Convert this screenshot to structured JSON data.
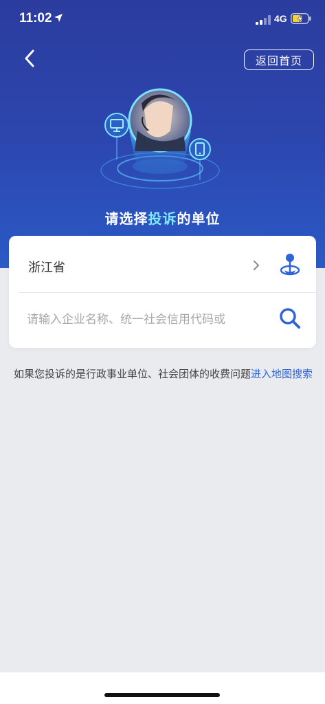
{
  "status_bar": {
    "time": "11:02",
    "network": "4G",
    "icons": [
      "location-arrow-icon",
      "signal-icon",
      "battery-charging-icon"
    ]
  },
  "header": {
    "back_icon": "chevron-left-icon",
    "home_button_label": "返回首页",
    "title_prefix": "请选择",
    "title_highlight": "投诉",
    "title_suffix": "的单位"
  },
  "form": {
    "province": "浙江省",
    "search_placeholder": "请输入企业名称、统一社会信用代码或",
    "search_value": "",
    "icons": [
      "chevron-right-icon",
      "map-pin-icon",
      "search-icon"
    ]
  },
  "note": {
    "text": "如果您投诉的是行政事业单位、社会团体的收费问题",
    "link_text": "进入地图搜索"
  },
  "colors": {
    "header_gradient_top": "#2b3c9e",
    "header_gradient_bottom": "#2a5ac6",
    "title_highlight": "#7fe7ff",
    "accent_blue": "#2f63d8",
    "page_background": "#e9ebef"
  }
}
